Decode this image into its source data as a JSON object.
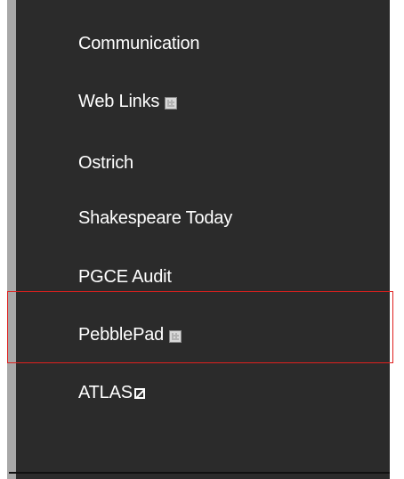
{
  "sidebar": {
    "items": [
      {
        "label": "Communication",
        "icon": null
      },
      {
        "label": "Web Links",
        "icon": "grid-box-icon"
      },
      {
        "label": "Ostrich",
        "icon": null
      },
      {
        "label": "Shakespeare Today",
        "icon": null
      },
      {
        "label": "PGCE Audit",
        "icon": null
      },
      {
        "label": "PebblePad",
        "icon": "grid-box-icon"
      },
      {
        "label": "ATLAS",
        "icon": "slashed-box-icon"
      }
    ],
    "highlighted_item": "PebblePad"
  },
  "colors": {
    "sidebar_bg": "#2b2b2b",
    "sidebar_border": "#a8a8a8",
    "text": "#ffffff",
    "highlight": "#e0201e"
  }
}
